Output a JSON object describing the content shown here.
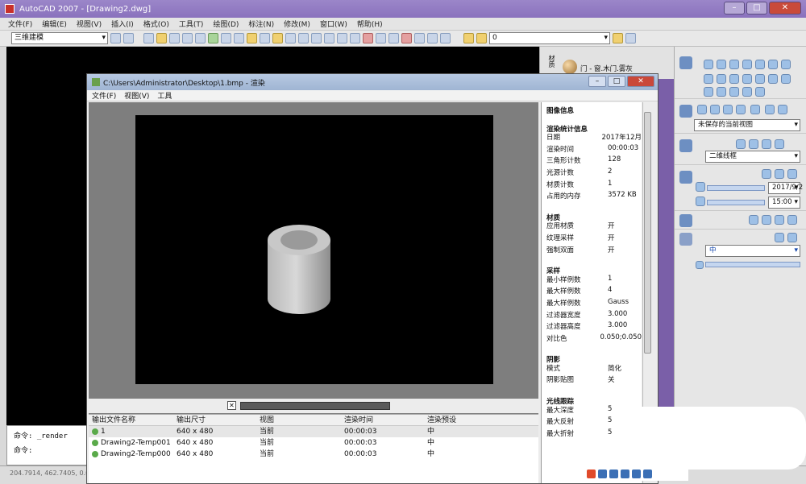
{
  "app": {
    "title": "AutoCAD 2007 - [Drawing2.dwg]"
  },
  "menu": [
    "文件(F)",
    "编辑(E)",
    "视图(V)",
    "插入(I)",
    "格式(O)",
    "工具(T)",
    "绘图(D)",
    "标注(N)",
    "修改(M)",
    "窗口(W)",
    "帮助(H)"
  ],
  "toolbar": {
    "workspace": "三维建模",
    "layer": "0"
  },
  "materials": {
    "label": "门 - 窗.木门.雾灰",
    "tab": "材质"
  },
  "command": {
    "line1": "命令: _render",
    "line2": "命令:"
  },
  "status": {
    "coords": "204.7914, 462.7405, 0.0"
  },
  "render_window": {
    "title": "C:\\Users\\Administrator\\Desktop\\1.bmp - 渲染",
    "menu": [
      "文件(F)",
      "视图(V)",
      "工具"
    ],
    "history": {
      "headers": [
        "输出文件名称",
        "输出尺寸",
        "视图",
        "渲染时间",
        "渲染预设"
      ],
      "rows": [
        {
          "name": "1",
          "size": "640 x 480",
          "view": "当前",
          "time": "00:00:03",
          "preset": "中"
        },
        {
          "name": "Drawing2-Temp001",
          "size": "640 x 480",
          "view": "当前",
          "time": "00:00:03",
          "preset": "中"
        },
        {
          "name": "Drawing2-Temp000",
          "size": "640 x 480",
          "view": "当前",
          "time": "00:00:03",
          "preset": "中"
        }
      ]
    },
    "stats": {
      "title": "图像信息",
      "sections": [
        {
          "heading": "渲染统计信息",
          "items": [
            {
              "k": "日期",
              "v": "2017年12月"
            },
            {
              "k": "渲染时间",
              "v": "00:00:03"
            },
            {
              "k": "三角形计数",
              "v": "128"
            },
            {
              "k": "光源计数",
              "v": "2"
            },
            {
              "k": "材质计数",
              "v": "1"
            },
            {
              "k": "占用的内存",
              "v": "3572 KB"
            }
          ]
        },
        {
          "heading": "材质",
          "items": [
            {
              "k": "应用材质",
              "v": "开"
            },
            {
              "k": "纹理采样",
              "v": "开"
            },
            {
              "k": "强制双面",
              "v": "开"
            }
          ]
        },
        {
          "heading": "采样",
          "items": [
            {
              "k": "最小样例数",
              "v": "1"
            },
            {
              "k": "最大样例数",
              "v": "4"
            },
            {
              "k": "最大样例数",
              "v": "Gauss"
            },
            {
              "k": "过滤器宽度",
              "v": "3.000"
            },
            {
              "k": "过滤器高度",
              "v": "3.000"
            },
            {
              "k": "对比色",
              "v": "0.050;0.050"
            }
          ]
        },
        {
          "heading": "阴影",
          "items": [
            {
              "k": "模式",
              "v": "简化"
            },
            {
              "k": "阴影贴图",
              "v": "关"
            }
          ]
        },
        {
          "heading": "光线跟踪",
          "items": [
            {
              "k": "最大深度",
              "v": "5"
            },
            {
              "k": "最大反射",
              "v": "5"
            },
            {
              "k": "最大折射",
              "v": "5"
            }
          ]
        }
      ]
    }
  },
  "dashboard": {
    "view": "未保存的当前视图",
    "visual_style": "二维线框",
    "date": "2017/9/2",
    "time": "15:00",
    "render_preset": "中"
  }
}
